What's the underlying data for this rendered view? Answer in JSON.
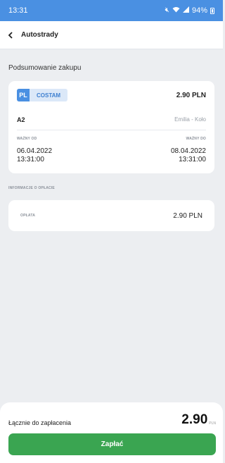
{
  "status_bar": {
    "time": "13:31",
    "battery": "94%",
    "mute_icon": "mute-icon",
    "wifi_icon": "wifi-icon",
    "signal_icon": "signal-icon"
  },
  "app_bar": {
    "back_icon": "chevron-left-icon",
    "title": "Autostrady"
  },
  "summary": {
    "title": "Podsumowanie zakupu",
    "plate_country": "PL",
    "plate_number": "COSTAM",
    "price": "2.90 PLN",
    "road": "A2",
    "route": "Emilia - Koło",
    "valid_from_label": "WAŻNY OD",
    "valid_from_date": "06.04.2022",
    "valid_from_time": "13:31:00",
    "valid_to_label": "WAŻNY DO",
    "valid_to_date": "08.04.2022",
    "valid_to_time": "13:31:00"
  },
  "payment_info": {
    "section_label": "INFORMACJE O OPŁACIE",
    "fee_label": "OPŁATA",
    "fee_value": "2.90 PLN"
  },
  "footer": {
    "total_label": "Łącznie do zapłacenia",
    "total_value": "2.90",
    "total_currency": "PLN",
    "pay_button": "Zapłać"
  },
  "colors": {
    "accent": "#4a90e2",
    "pay_green": "#3aa551",
    "background": "#eceef1"
  }
}
